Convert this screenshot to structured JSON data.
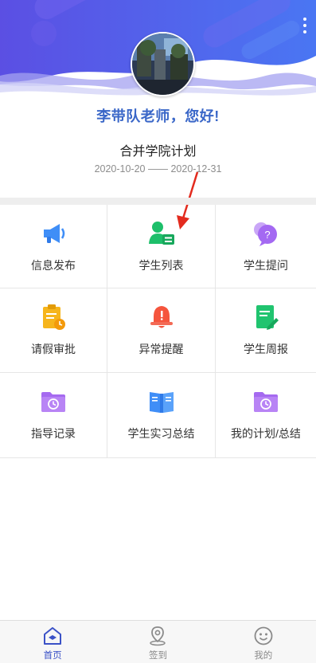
{
  "header": {
    "greeting": "李带队老师，您好!",
    "plan_name": "合并学院计划",
    "date_start": "2020-10-20",
    "date_separator": "——",
    "date_end": "2020-12-31"
  },
  "grid": {
    "items": [
      {
        "label": "信息发布",
        "icon": "megaphone-icon",
        "color": "#3f8ef7"
      },
      {
        "label": "学生列表",
        "icon": "student-card-icon",
        "color": "#1dbf6a"
      },
      {
        "label": "学生提问",
        "icon": "question-bubble-icon",
        "color": "#a469f2"
      },
      {
        "label": "请假审批",
        "icon": "clipboard-clock-icon",
        "color": "#f6b51c"
      },
      {
        "label": "异常提醒",
        "icon": "alarm-bell-icon",
        "color": "#f5553d"
      },
      {
        "label": "学生周报",
        "icon": "report-edit-icon",
        "color": "#20c46f"
      },
      {
        "label": "指导记录",
        "icon": "folder-clock-icon",
        "color": "#a56af0"
      },
      {
        "label": "学生实习总结",
        "icon": "open-book-icon",
        "color": "#3f8ef7"
      },
      {
        "label": "我的计划/总结",
        "icon": "folder-clock-icon",
        "color": "#a56af0"
      }
    ]
  },
  "tabbar": {
    "tabs": [
      {
        "label": "首页",
        "icon": "home-icon",
        "active": true
      },
      {
        "label": "签到",
        "icon": "location-pin-icon",
        "active": false
      },
      {
        "label": "我的",
        "icon": "smiley-icon",
        "active": false
      }
    ]
  },
  "colors": {
    "header_gradient_start": "#5b52e6",
    "header_gradient_end": "#4a73f2",
    "greeting": "#3a67c8",
    "tab_active": "#3b52c7"
  }
}
